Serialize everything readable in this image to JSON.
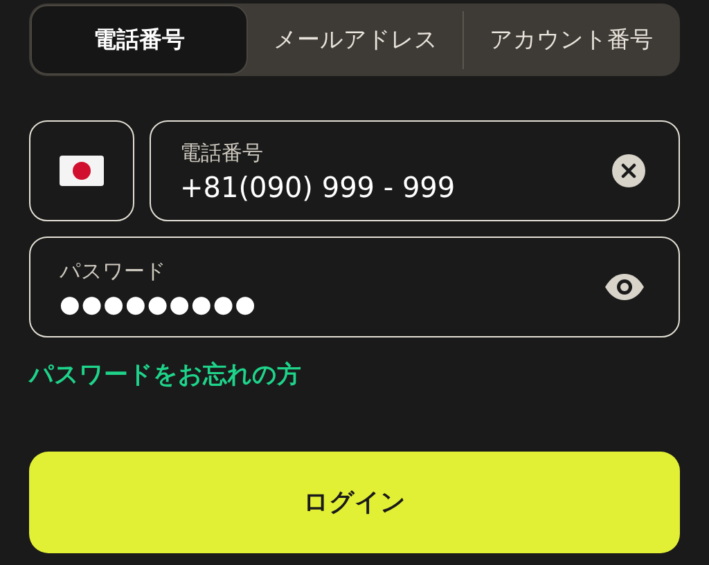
{
  "tabs": [
    {
      "label": "電話番号",
      "selected": true
    },
    {
      "label": "メールアドレス",
      "selected": false
    },
    {
      "label": "アカウント番号",
      "selected": false
    }
  ],
  "phone": {
    "label": "電話番号",
    "value": "+81(090) 999 - 999"
  },
  "password": {
    "label": "パスワード",
    "value": "●●●●●●●●●"
  },
  "forgot_link": "パスワードをお忘れの方",
  "login_button": "ログイン"
}
